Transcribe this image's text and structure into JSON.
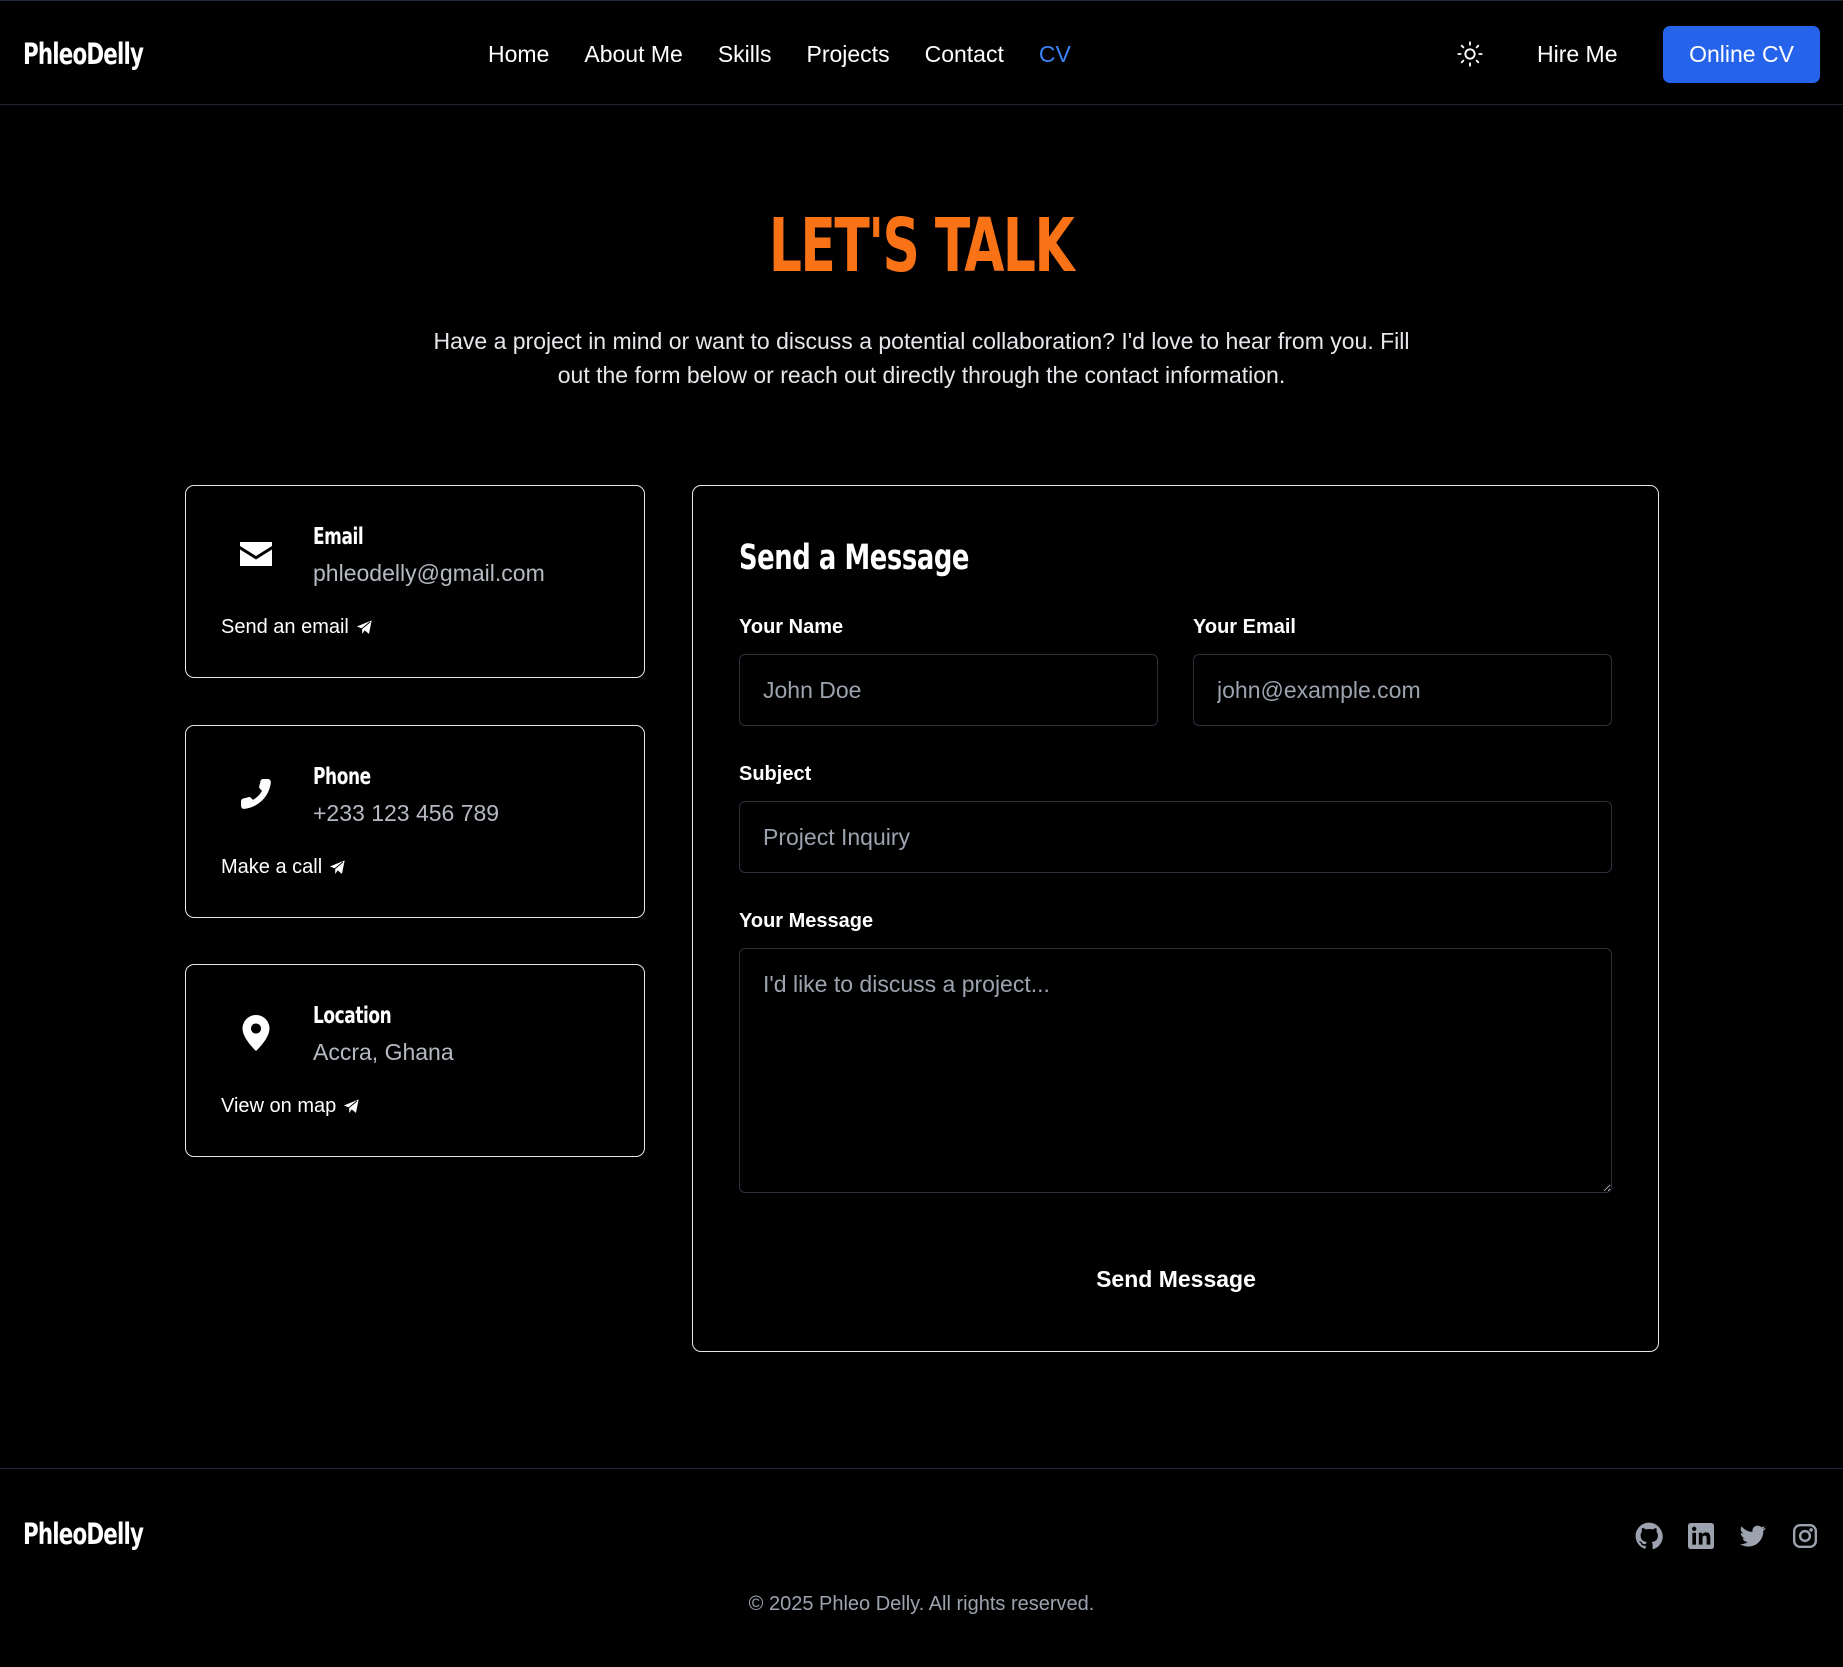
{
  "nav": {
    "brand": "PhleoDelly",
    "links": [
      {
        "label": "Home"
      },
      {
        "label": "About Me"
      },
      {
        "label": "Skills"
      },
      {
        "label": "Projects"
      },
      {
        "label": "Contact"
      },
      {
        "label": "CV",
        "active": true
      }
    ],
    "theme_icon": "sun-icon",
    "hire_label": "Hire Me",
    "cv_button_label": "Online CV"
  },
  "hero": {
    "title": "LET'S TALK",
    "subtitle_line1": "Have a project in mind or want to discuss a potential collaboration? I'd love to hear from you. Fill",
    "subtitle_line2": "out the form below or reach out directly through the contact information."
  },
  "contact_cards": [
    {
      "icon": "envelope-icon",
      "title": "Email",
      "value": "phleodelly@gmail.com",
      "action": "Send an email"
    },
    {
      "icon": "phone-icon",
      "title": "Phone",
      "value": "+233 123 456 789",
      "action": "Make a call"
    },
    {
      "icon": "map-pin-icon",
      "title": "Location",
      "value": "Accra, Ghana",
      "action": "View on map"
    }
  ],
  "form": {
    "title": "Send a Message",
    "name_label": "Your Name",
    "name_placeholder": "John Doe",
    "email_label": "Your Email",
    "email_placeholder": "john@example.com",
    "subject_label": "Subject",
    "subject_placeholder": "Project Inquiry",
    "message_label": "Your Message",
    "message_placeholder": "I'd like to discuss a project...",
    "submit_label": "Send Message"
  },
  "footer": {
    "brand": "PhleoDelly",
    "socials": [
      "github-icon",
      "linkedin-icon",
      "twitter-icon",
      "instagram-icon"
    ],
    "copyright": "© 2025 Phleo Delly. All rights reserved."
  },
  "colors": {
    "background": "#000000",
    "accent_orange": "#f97316",
    "accent_blue": "#2563eb",
    "active_link": "#3b82f6",
    "muted_text": "#9ca3af"
  }
}
